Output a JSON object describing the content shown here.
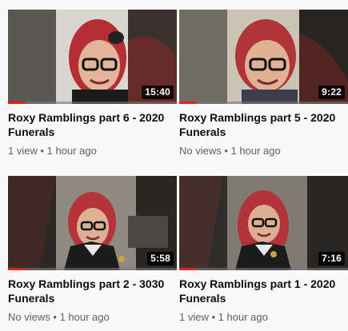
{
  "videos": [
    {
      "title": "Roxy Ramblings part 6 - 2020 Funerals",
      "duration": "15:40",
      "views": "1 view",
      "age": "1 hour ago",
      "progress": 0.1
    },
    {
      "title": "Roxy Ramblings part 5 - 2020 Funerals",
      "duration": "9:22",
      "views": "No views",
      "age": "1 hour ago",
      "progress": 0.1
    },
    {
      "title": "Roxy Ramblings part 2 - 3030 Funerals",
      "duration": "5:58",
      "views": "No views",
      "age": "1 hour ago",
      "progress": 0.1
    },
    {
      "title": "Roxy Ramblings part 1 - 2020 Funerals",
      "duration": "7:16",
      "views": "1 view",
      "age": "1 hour ago",
      "progress": 0.1
    }
  ],
  "meta_separator": "•",
  "colors": {
    "progress": "#e62117",
    "hair": "#b32f33",
    "background": "#f9f9f9"
  }
}
